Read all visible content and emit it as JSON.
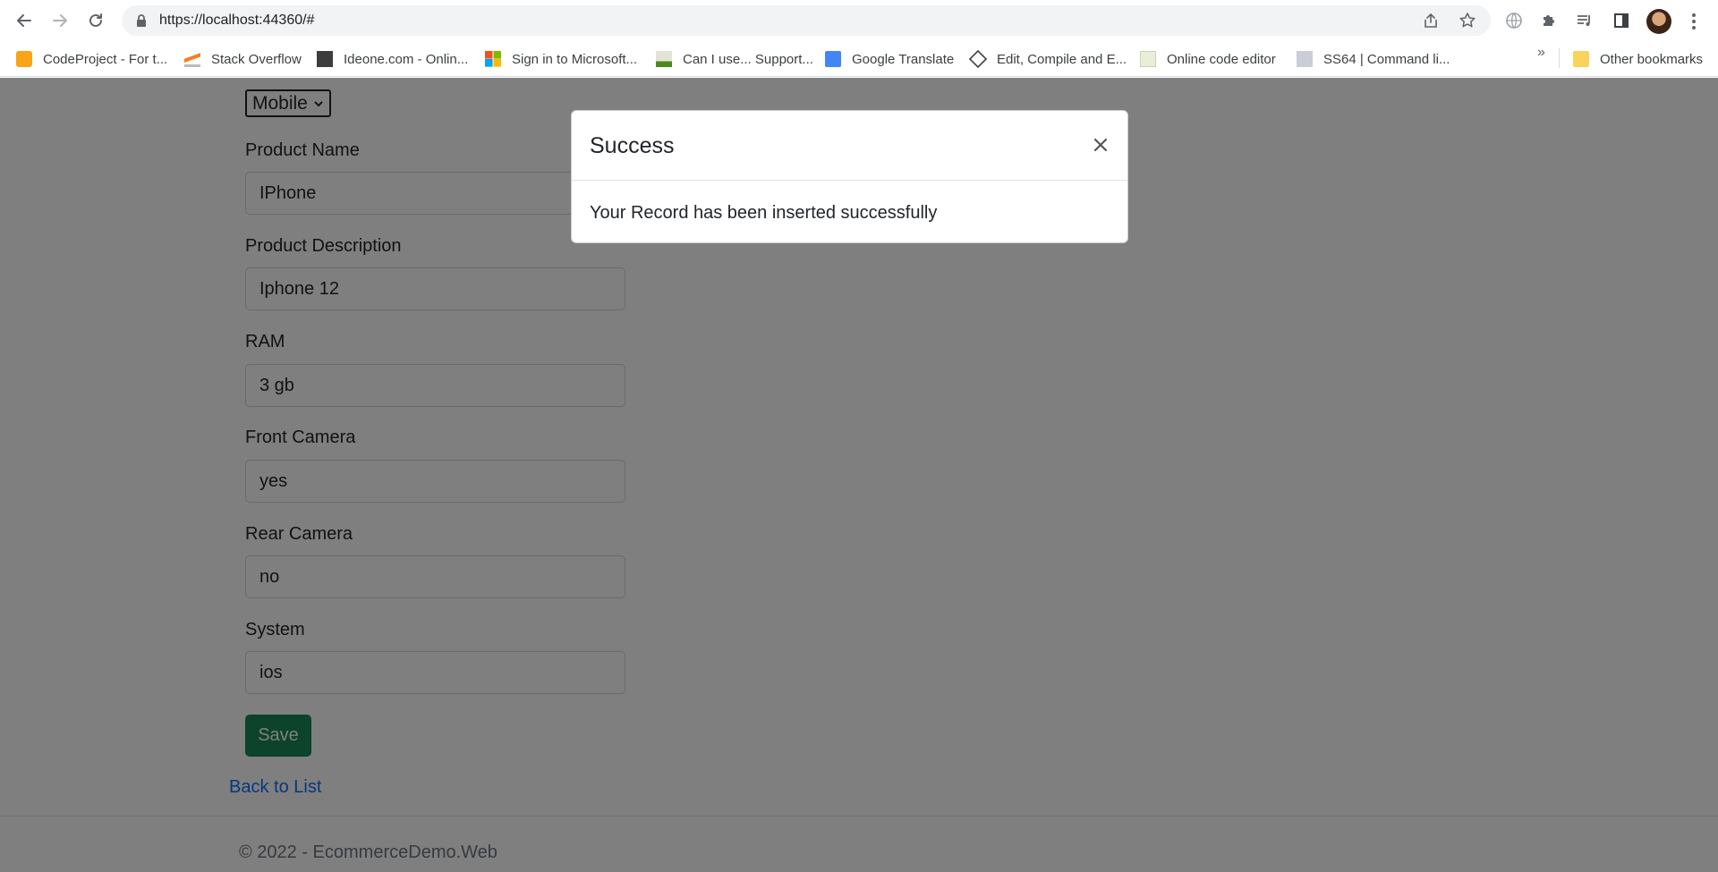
{
  "browser": {
    "url": "https://localhost:44360/#",
    "icons": {
      "back": "arrow-left-icon",
      "forward": "arrow-right-icon",
      "reload": "reload-icon",
      "lock": "lock-icon",
      "share": "share-icon",
      "bookmark": "star-icon",
      "translate": "globe-icon",
      "extensions": "puzzle-icon",
      "media": "playlist-icon",
      "sidepanel": "side-panel-icon",
      "menu": "kebab-menu-icon"
    },
    "bookmarks": [
      {
        "label": "CodeProject - For t...",
        "icon": "codeproject-icon"
      },
      {
        "label": "Stack Overflow",
        "icon": "stackoverflow-icon"
      },
      {
        "label": "Ideone.com - Onlin...",
        "icon": "ideone-icon"
      },
      {
        "label": "Sign in to Microsoft...",
        "icon": "microsoft-icon"
      },
      {
        "label": "Can I use... Support...",
        "icon": "caniuse-icon"
      },
      {
        "label": "Google Translate",
        "icon": "google-translate-icon"
      },
      {
        "label": "Edit, Compile and E...",
        "icon": "compiler-icon"
      },
      {
        "label": "Online code editor",
        "icon": "code-editor-icon"
      },
      {
        "label": "SS64 | Command li...",
        "icon": "ss64-icon"
      }
    ],
    "more_bookmarks": "»",
    "other_bookmarks": "Other bookmarks"
  },
  "form": {
    "category_value": "Mobile",
    "fields": [
      {
        "label": "Product Name",
        "value": "IPhone"
      },
      {
        "label": "Product Description",
        "value": "Iphone 12"
      },
      {
        "label": "RAM",
        "value": "3 gb"
      },
      {
        "label": "Front Camera",
        "value": "yes"
      },
      {
        "label": "Rear Camera",
        "value": "no"
      },
      {
        "label": "System",
        "value": "ios"
      }
    ],
    "save_label": "Save",
    "back_link": "Back to List"
  },
  "footer": {
    "text": "© 2022 - EcommerceDemo.Web"
  },
  "modal": {
    "title": "Success",
    "close_label": "×",
    "message": "Your Record has been inserted successfully"
  },
  "colors": {
    "save_button": "#198754",
    "link": "#0d6efd",
    "backdrop": "rgba(0,0,0,0.5)"
  }
}
